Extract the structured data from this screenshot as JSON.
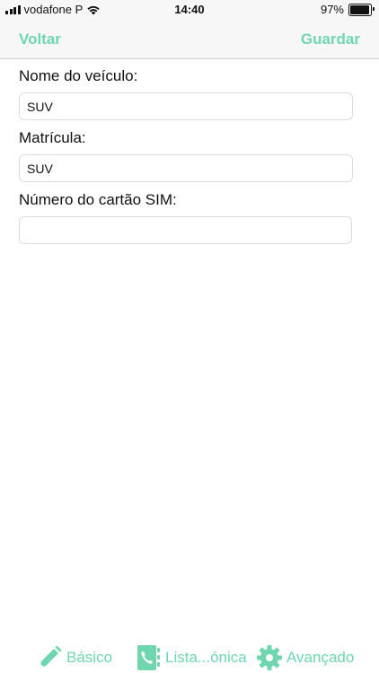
{
  "status_bar": {
    "carrier": "vodafone P",
    "time": "14:40",
    "battery": "97%",
    "battery_level": 0.97
  },
  "nav": {
    "back_label": "Voltar",
    "save_label": "Guardar"
  },
  "form": {
    "vehicle_name": {
      "label": "Nome do veículo:",
      "value": "SUV"
    },
    "plate": {
      "label": "Matrícula:",
      "value": "SUV"
    },
    "sim_number": {
      "label": "Número do cartão SIM:",
      "value": ""
    }
  },
  "tabs": [
    {
      "label": "Básico",
      "icon": "pencil-icon"
    },
    {
      "label": "Lista...ónica",
      "icon": "phonebook-icon"
    },
    {
      "label": "Avançado",
      "icon": "gear-icon"
    }
  ],
  "colors": {
    "accent": "#6fd6b0"
  }
}
